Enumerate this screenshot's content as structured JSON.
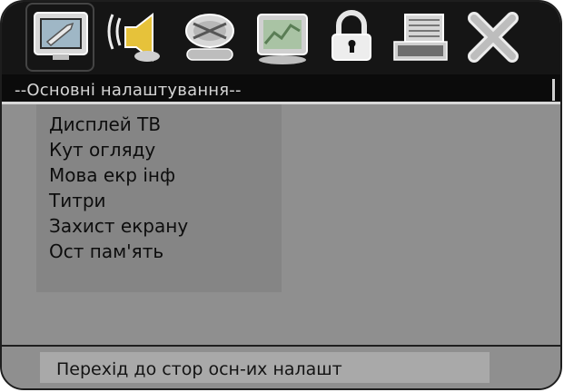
{
  "toolbar": {
    "icons": [
      {
        "name": "general-setup-icon"
      },
      {
        "name": "audio-setup-icon"
      },
      {
        "name": "dolby-setup-icon"
      },
      {
        "name": "video-setup-icon"
      },
      {
        "name": "preference-lock-icon"
      },
      {
        "name": "mpeg4-setup-icon"
      },
      {
        "name": "exit-icon"
      }
    ],
    "selected_index": 0
  },
  "section": {
    "title": "--Основні налаштування--"
  },
  "menu": {
    "items": [
      {
        "label": "Дисплей ТВ"
      },
      {
        "label": "Кут огляду"
      },
      {
        "label": "Мова екр інф"
      },
      {
        "label": "Титри"
      },
      {
        "label": "Захист екрану"
      },
      {
        "label": "Ост пам'ять"
      }
    ]
  },
  "help": {
    "text": "Перехід до стор осн-их налашт"
  },
  "colors": {
    "background": "#8f8f8f",
    "panel": "#858585",
    "bar": "#151515",
    "title_text": "#d6d6d6"
  }
}
